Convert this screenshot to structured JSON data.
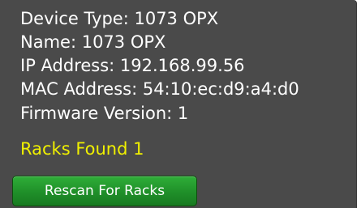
{
  "device": {
    "type_line": "Device Type: 1073 OPX",
    "name_line": "Name: 1073 OPX",
    "ip_line": "IP Address: 192.168.99.56",
    "mac_line": "MAC Address: 54:10:ec:d9:a4:d0",
    "firmware_line": "Firmware Version: 1"
  },
  "racks": {
    "found_text": "Racks Found 1",
    "found_color": "#f0f000"
  },
  "actions": {
    "rescan_label": "Rescan For Racks",
    "rescan_color": "#1f8f29"
  },
  "colors": {
    "panel_background": "#4a4a4a",
    "text": "#ffffff"
  }
}
